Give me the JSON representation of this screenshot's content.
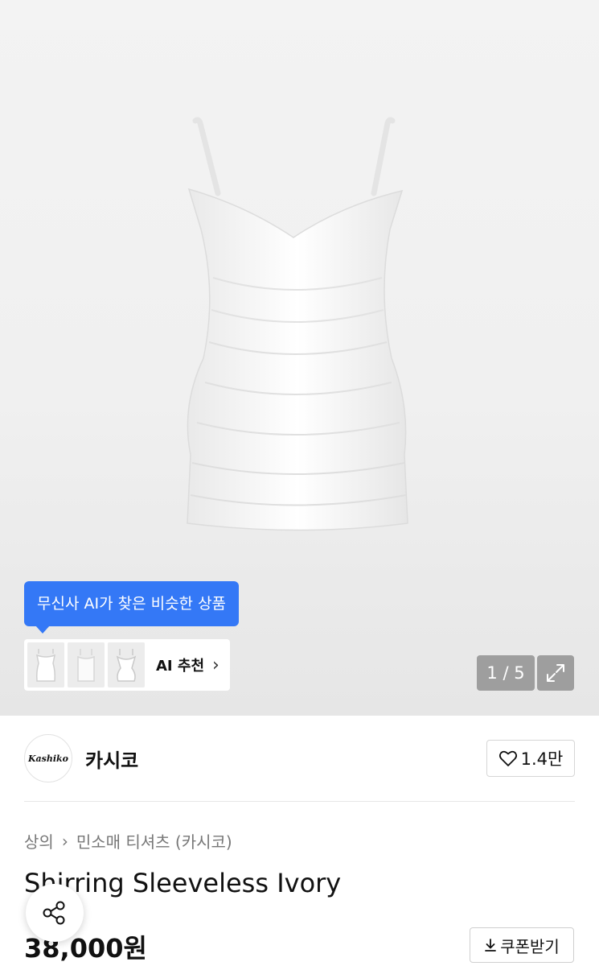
{
  "gallery": {
    "ai_tooltip": "무신사 AI가 찾은 비슷한 상품",
    "ai_recommend_label": "AI 추천",
    "pager": "1 / 5"
  },
  "brand": {
    "logo_text": "Kashiko",
    "name": "카시코",
    "likes": "1.4만"
  },
  "breadcrumb": {
    "level1": "상의",
    "level2": "민소매 티셔츠 (카시코)"
  },
  "product": {
    "title": "Shirring Sleeveless Ivory",
    "price": "38,000원"
  },
  "coupon": {
    "label": "쿠폰받기"
  },
  "icons": [
    "expand-icon",
    "heart-icon",
    "chevron-right-icon",
    "download-icon",
    "share-icon"
  ],
  "colors": {
    "accent_blue": "#3478f6",
    "overlay_grey": "#9e9e9e"
  }
}
